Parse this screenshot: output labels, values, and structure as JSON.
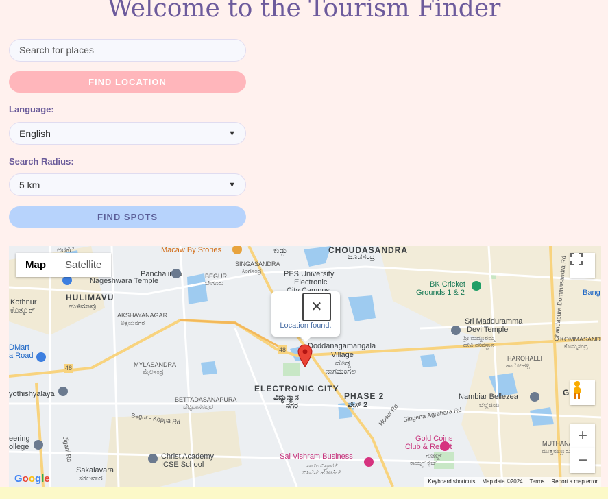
{
  "header": {
    "title": "Welcome to the Tourism Finder"
  },
  "search": {
    "placeholder": "Search for places",
    "value": ""
  },
  "find_location_label": "FIND LOCATION",
  "language": {
    "label": "Language:",
    "selected": "English"
  },
  "radius": {
    "label": "Search Radius:",
    "selected": "5 km"
  },
  "find_spots_label": "FIND SPOTS",
  "colors": {
    "title": "#6d5b9c",
    "find_location_bg": "#ffb6bb",
    "find_spots_bg": "#b7d3fc",
    "page_bg": "#fff1ee"
  },
  "map": {
    "type_control": {
      "map": "Map",
      "satellite": "Satellite"
    },
    "popup": {
      "close_icon": "close-icon",
      "text": "Location found."
    },
    "labels": {
      "arakere": "ಅರಕೆರೆ",
      "macaw": "Macaw By Stories",
      "kudlu": "ಕುಡ್ಲು",
      "choudasandra": "CHOUDASANDRA",
      "choudasandra_kn": "ಚೂಡಸಂದ್ರ",
      "singasandra": "SINGASANDRA",
      "singasandra_kn": "ಸಿಂಗಸಂದ್ರ",
      "panchalinga": "Panchalinga",
      "nageshwara": "Nageshwara Temple",
      "begur": "BEGUR",
      "begur_kn": "ಬೇಗೂರು",
      "pes1": "PES University",
      "pes2": "Electronic",
      "pes3": "City Campus",
      "bk1": "BK Cricket",
      "bk2": "Grounds 1 & 2",
      "bang": "Bang",
      "kothnur": "Kothnur",
      "kothnur_kn": "ಕೊತ್ನೂರ್",
      "hulimavu": "HULIMAVU",
      "hulimavu_kn": "ಹುಳಿಮಾವು",
      "akshayanagar": "AKSHAYANAGAR",
      "akshayanagar_kn": "ಅಕ್ಷಯನಗರ",
      "madduramma1": "Sri Madduramma",
      "madduramma2": "Devi Temple",
      "madduramma3": "ಶ್ರೀ ಮದ್ದೂರಮ್ಮ",
      "madduramma4": "ದೇವಿ ದೇವಸ್ಥಾನ",
      "kommasandra": "KOMMASANDRA",
      "kommasandra_kn": "ಕೊಮ್ಮಸಂದ್ರ",
      "dmart": "DMart",
      "road": "a Road",
      "doddanagamangala1": "Doddanagamangala",
      "doddanagamangala2": "Village",
      "doddanagamangala3": "ದೊಡ್ಡ",
      "doddanagamangala4": "ನಾಗಮಂಗಲ",
      "harohalli": "HAROHALLI",
      "harohalli_kn": "ಹಾರೋಹಳ್ಳಿ",
      "mylasandra": "MYLASANDRA",
      "mylasandra_kn": "ಮೈಲಸಂದ್ರ",
      "nh48a": "48",
      "nh48b": "48",
      "electronic_city": "ELECTRONIC CITY",
      "electronic_city_kn1": "ವಿದ್ಯುನ್ಮಾನ",
      "electronic_city_kn2": "ನಗರ",
      "phase2": "PHASE 2",
      "phase2_kn": "ಫೇಸ್ 2",
      "nambiar1": "Nambiar Bellezea",
      "nambiar2": "ಬೆಲ್ಲೆಜಿಯ",
      "jothishyalaya": "yothishyalaya",
      "bettadasanapura": "BETTADASANAPURA",
      "bettadasanapura_kn": "ಬೆಟ್ಟದಾಸನಪುರ",
      "begur_koppa": "Begur - Koppa Rd",
      "hosur_rd": "Hosur Rd",
      "singena": "Singena Agrahara Rd",
      "gold1": "Gold Coins",
      "gold2": "Club & Resort",
      "gold3": "ಗೋಲ್ಡ್",
      "gold4": "ಕಾಯ್ನ್ಸ್ ಕ್ಲಬ್",
      "muthanal": "MUTHANAL",
      "muthanal_kn": "ಮುತ್ತನಲ್ಲೂರು",
      "college1": "eering",
      "college2": "ollege",
      "sai1": "Sai Vishram Business",
      "sai2": "ಸಾಯಿ ವಿಶ್ರಾಮ್",
      "sai3": "ಬಿಸಿನೆಸ್ ಹೋಟೆಲ್",
      "christ1": "Christ Academy",
      "christ2": "ICSE School",
      "sakalavara": "Sakalavara",
      "sakalavara_kn": "ಸಕಲವಾರ",
      "chandapura": "Chandapura Dommasandra Rd",
      "jigani": "Jigani Rd",
      "g": "G"
    },
    "attribution": "Google",
    "footer": {
      "shortcuts": "Keyboard shortcuts",
      "data": "Map data ©2024",
      "terms": "Terms",
      "report": "Report a map error"
    },
    "zoom_in": "+",
    "zoom_out": "−"
  }
}
